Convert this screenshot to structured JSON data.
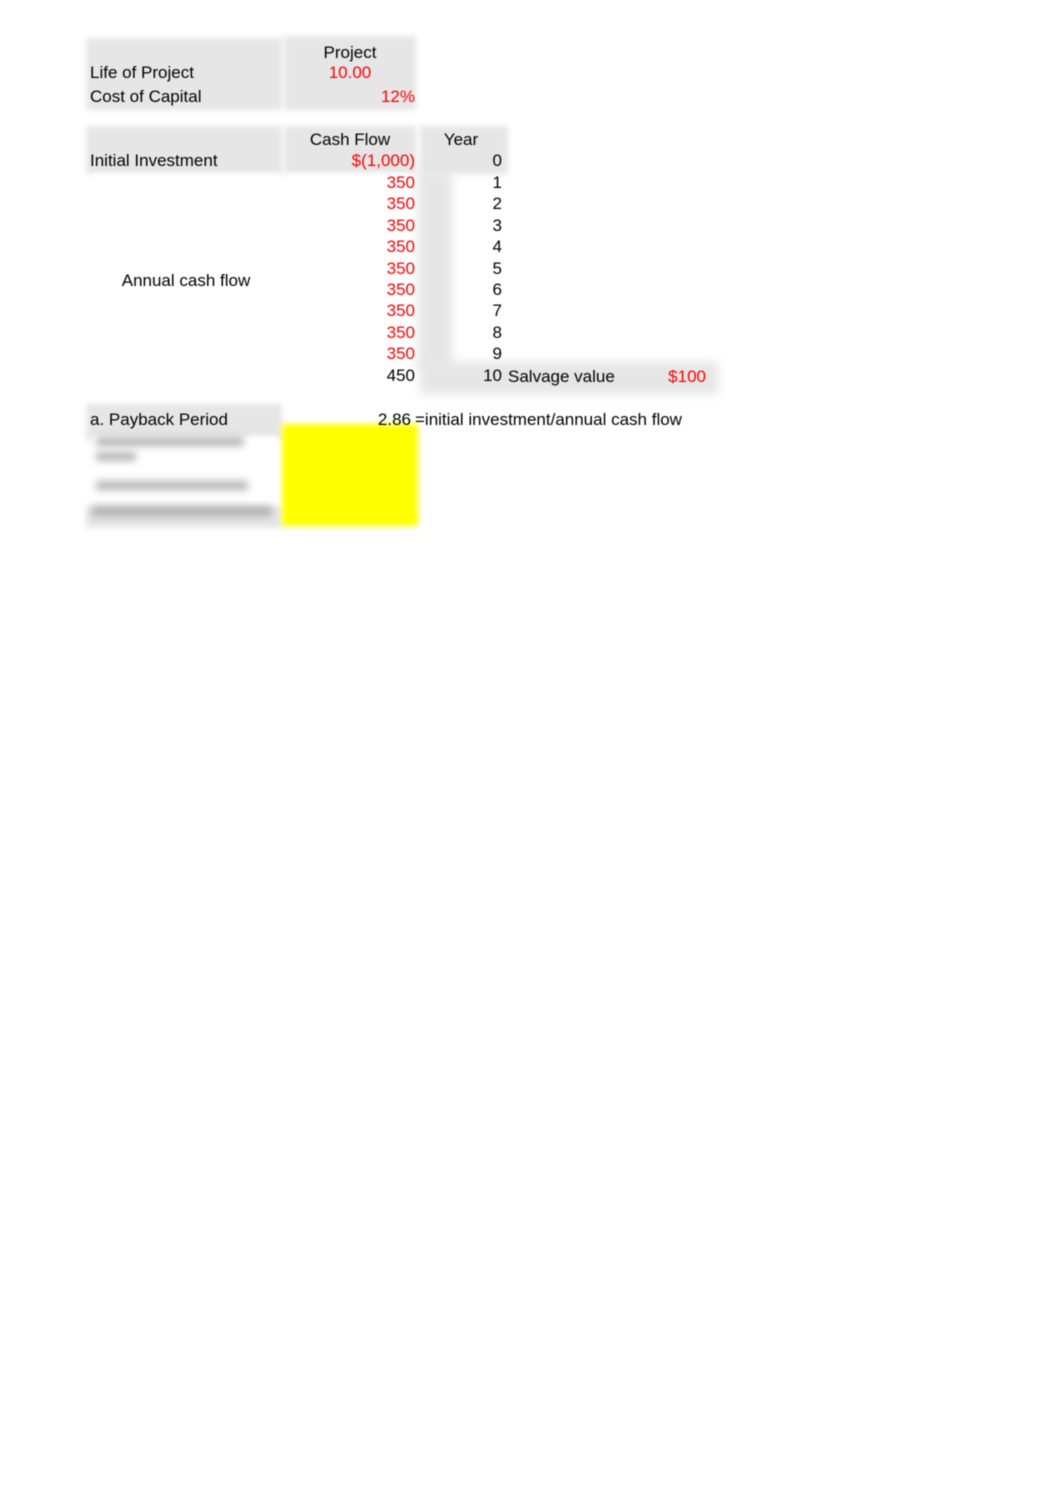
{
  "document": {
    "type": "spreadsheet",
    "title": "Capital Budgeting Worksheet"
  },
  "assumptions": {
    "column_header": "Project",
    "rows": [
      {
        "label": "Life of Project",
        "value": "10.00",
        "color": "#ff0000",
        "align": "center"
      },
      {
        "label": "Cost of Capital",
        "value": "12%",
        "color": "#ff0000",
        "align": "right"
      }
    ]
  },
  "cash_flow_table": {
    "headers": {
      "cash_flow": "Cash Flow",
      "year": "Year"
    },
    "initial_investment": {
      "label": "Initial Investment",
      "cash_flow": "$(1,000)",
      "year": "0",
      "color": "#ff0000"
    },
    "annual_label": "Annual cash flow",
    "rows": [
      {
        "cash_flow": "350",
        "year": "1",
        "color": "#ff0000"
      },
      {
        "cash_flow": "350",
        "year": "2",
        "color": "#ff0000"
      },
      {
        "cash_flow": "350",
        "year": "3",
        "color": "#ff0000"
      },
      {
        "cash_flow": "350",
        "year": "4",
        "color": "#ff0000"
      },
      {
        "cash_flow": "350",
        "year": "5",
        "color": "#ff0000"
      },
      {
        "cash_flow": "350",
        "year": "6",
        "color": "#ff0000"
      },
      {
        "cash_flow": "350",
        "year": "7",
        "color": "#ff0000"
      },
      {
        "cash_flow": "350",
        "year": "8",
        "color": "#ff0000"
      },
      {
        "cash_flow": "350",
        "year": "9",
        "color": "#ff0000"
      },
      {
        "cash_flow": "450",
        "year": "10",
        "color": "#000000"
      }
    ],
    "salvage": {
      "label": "Salvage value",
      "value": "$100",
      "color": "#ff0000"
    }
  },
  "payback": {
    "label": "a. Payback Period",
    "value": "2.86",
    "formula_note": "=initial investment/annual cash flow",
    "highlight_color": "#ffff00"
  },
  "colors": {
    "input_red": "#ff0000",
    "computed_black": "#000000",
    "cell_shade": "#e6e6e6",
    "highlight": "#ffff00"
  }
}
